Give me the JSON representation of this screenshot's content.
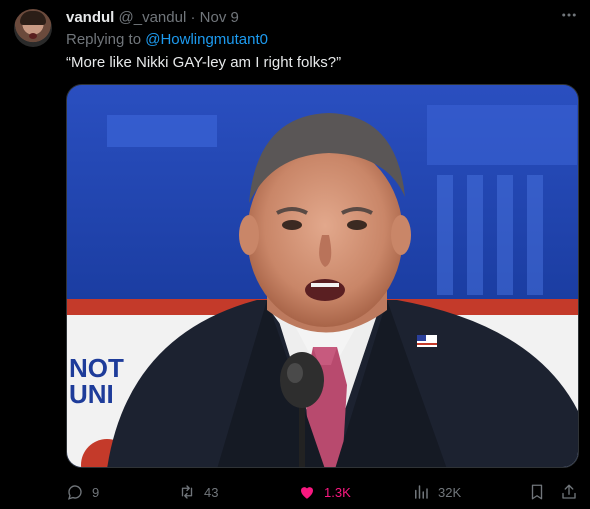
{
  "author": {
    "name": "vandul",
    "handle": "@_vandul",
    "separator": "·",
    "date": "Nov 9"
  },
  "reply_to": {
    "prefix": "Replying to ",
    "mention": "@Howlingmutant0"
  },
  "tweet_text": "“More like Nikki GAY-ley am I right folks?”",
  "media": {
    "background_sign_text": [
      "NOT",
      "UNI"
    ]
  },
  "actions": {
    "replies": "9",
    "retweets": "43",
    "likes": "1.3K",
    "views": "32K"
  },
  "icons": {
    "more": "more-icon",
    "reply": "reply-icon",
    "retweet": "retweet-icon",
    "like": "heart-icon",
    "views": "views-icon",
    "bookmark": "bookmark-icon",
    "share": "share-icon"
  },
  "colors": {
    "background": "#000000",
    "text": "#e7e9ea",
    "muted": "#71767b",
    "link": "#1d9bf0",
    "like": "#f91880"
  }
}
